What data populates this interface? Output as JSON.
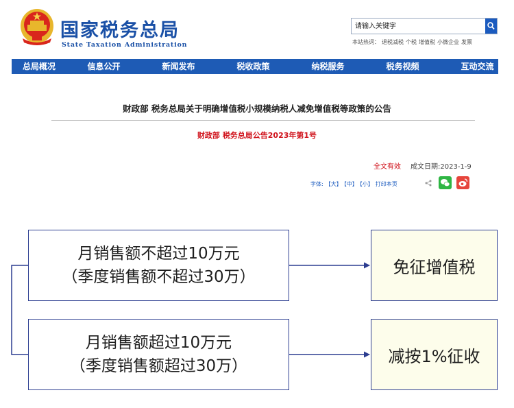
{
  "header": {
    "site_title": "国家税务总局",
    "site_subtitle": "State Taxation Administration",
    "search_placeholder": "请输入关键字",
    "hot_label": "本站热词：",
    "hot_words": [
      "退税减税",
      "个税",
      "增值税",
      "小微企业",
      "发票"
    ]
  },
  "nav": {
    "items": [
      "总局概况",
      "信息公开",
      "新闻发布",
      "税收政策",
      "纳税服务",
      "税务视频",
      "互动交流"
    ]
  },
  "article": {
    "title": "财政部 税务总局关于明确增值税小规模纳税人减免增值税等政策的公告",
    "doc_number": "财政部 税务总局公告2023年第1号",
    "validity": "全文有效",
    "date_label": "成文日期:",
    "date": "2023-1-9",
    "font_label": "字体:",
    "font_large": "【大】",
    "font_medium": "【中】",
    "font_small": "【小】",
    "print_label": "打印本页"
  },
  "diagram": {
    "conditions": [
      {
        "line1": "月销售额不超过10万元",
        "line2": "（季度销售额不超过30万）"
      },
      {
        "line1": "月销售额超过10万元",
        "line2": "（季度销售额超过30万）"
      }
    ],
    "results": [
      "免征增值税",
      "减按1%征收"
    ],
    "colors": {
      "border": "#2c3d90",
      "result_fill": "#fdfdeb",
      "nav": "#1e5bb5",
      "title_blue": "#1a50a6",
      "red": "#d0121b"
    }
  }
}
